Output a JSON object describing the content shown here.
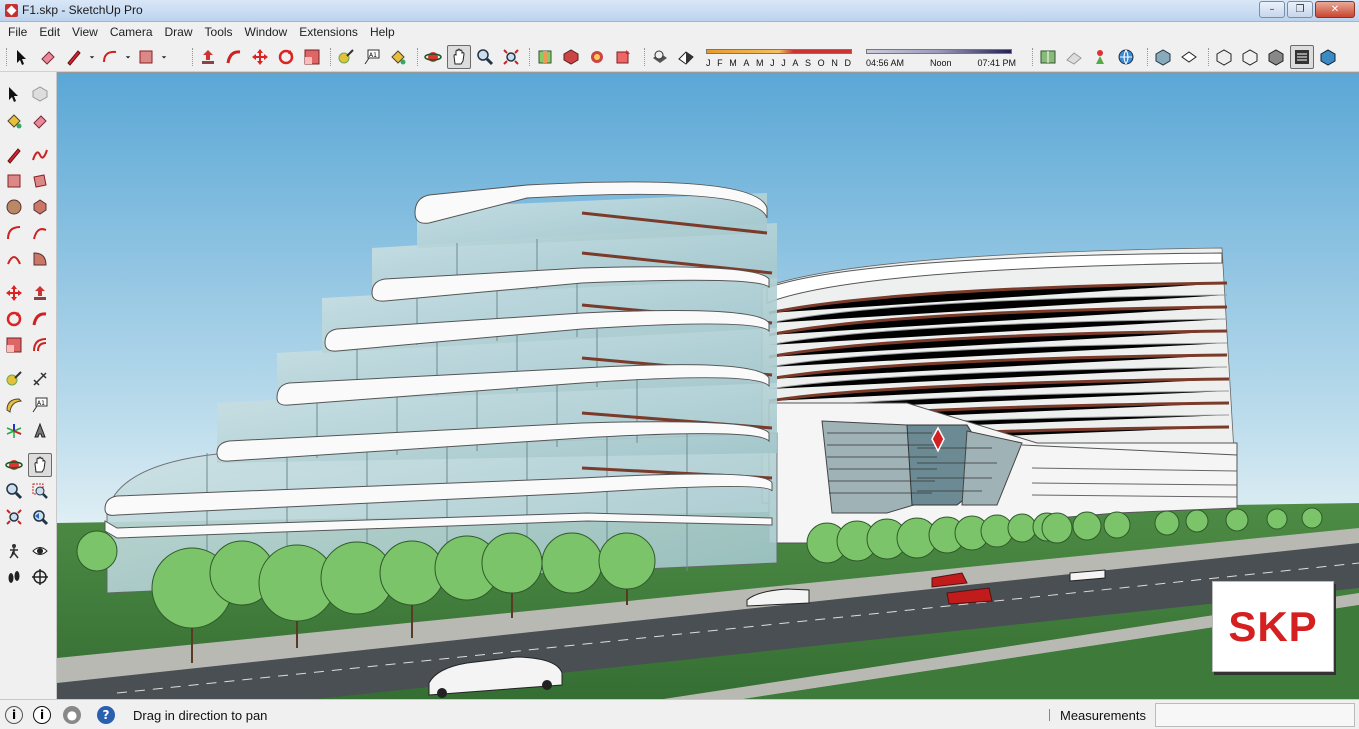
{
  "window": {
    "title": "F1.skp - SketchUp Pro",
    "controls": {
      "minimize": "–",
      "maximize": "❐",
      "close": "✕"
    }
  },
  "menu": [
    "File",
    "Edit",
    "View",
    "Camera",
    "Draw",
    "Tools",
    "Window",
    "Extensions",
    "Help"
  ],
  "toolbar": {
    "tools": [
      "select",
      "eraser",
      "pencil",
      "arc",
      "rectangle",
      "push-pull",
      "follow-me",
      "move",
      "rotate",
      "scale",
      "tape-measure",
      "text",
      "paint",
      "orbit",
      "pan",
      "zoom",
      "zoom-extents",
      "section",
      "components",
      "3d-warehouse",
      "extension-warehouse",
      "shadows",
      "fog"
    ],
    "active_tool": "pan",
    "shadow": {
      "months": [
        "J",
        "F",
        "M",
        "A",
        "M",
        "J",
        "J",
        "A",
        "S",
        "O",
        "N",
        "D"
      ],
      "time_start": "04:56 AM",
      "time_mid": "Noon",
      "time_end": "07:41 PM"
    },
    "view_tools": [
      "iso",
      "top",
      "front",
      "right",
      "back",
      "left",
      "xray",
      "wireframe",
      "hidden-line",
      "shaded",
      "shaded-textures",
      "monochrome"
    ]
  },
  "left_tools": [
    "select",
    "make-component",
    "paint",
    "eraser",
    "line",
    "freehand",
    "rectangle",
    "rotated-rectangle",
    "circle",
    "polygon",
    "arc",
    "two-point-arc",
    "three-point-arc",
    "pie",
    "move",
    "push-pull",
    "rotate",
    "follow-me",
    "scale",
    "offset",
    "tape-measure",
    "dimension",
    "protractor",
    "text",
    "axes",
    "3d-text",
    "orbit",
    "pan",
    "zoom",
    "zoom-window",
    "zoom-extents",
    "previous",
    "position-camera",
    "look-around",
    "walk",
    "section-plane"
  ],
  "viewport": {
    "watermark": "SKP",
    "colors": {
      "sky_top": "#5aa7d6",
      "sky_bottom": "#d8ebf3",
      "grass": "#3e7a3a",
      "road": "#4a4f54",
      "tree": "#7cc46a",
      "accent": "#d42020"
    }
  },
  "status": {
    "message": "Drag in direction to pan",
    "measurements_label": "Measurements",
    "measurements_value": ""
  }
}
